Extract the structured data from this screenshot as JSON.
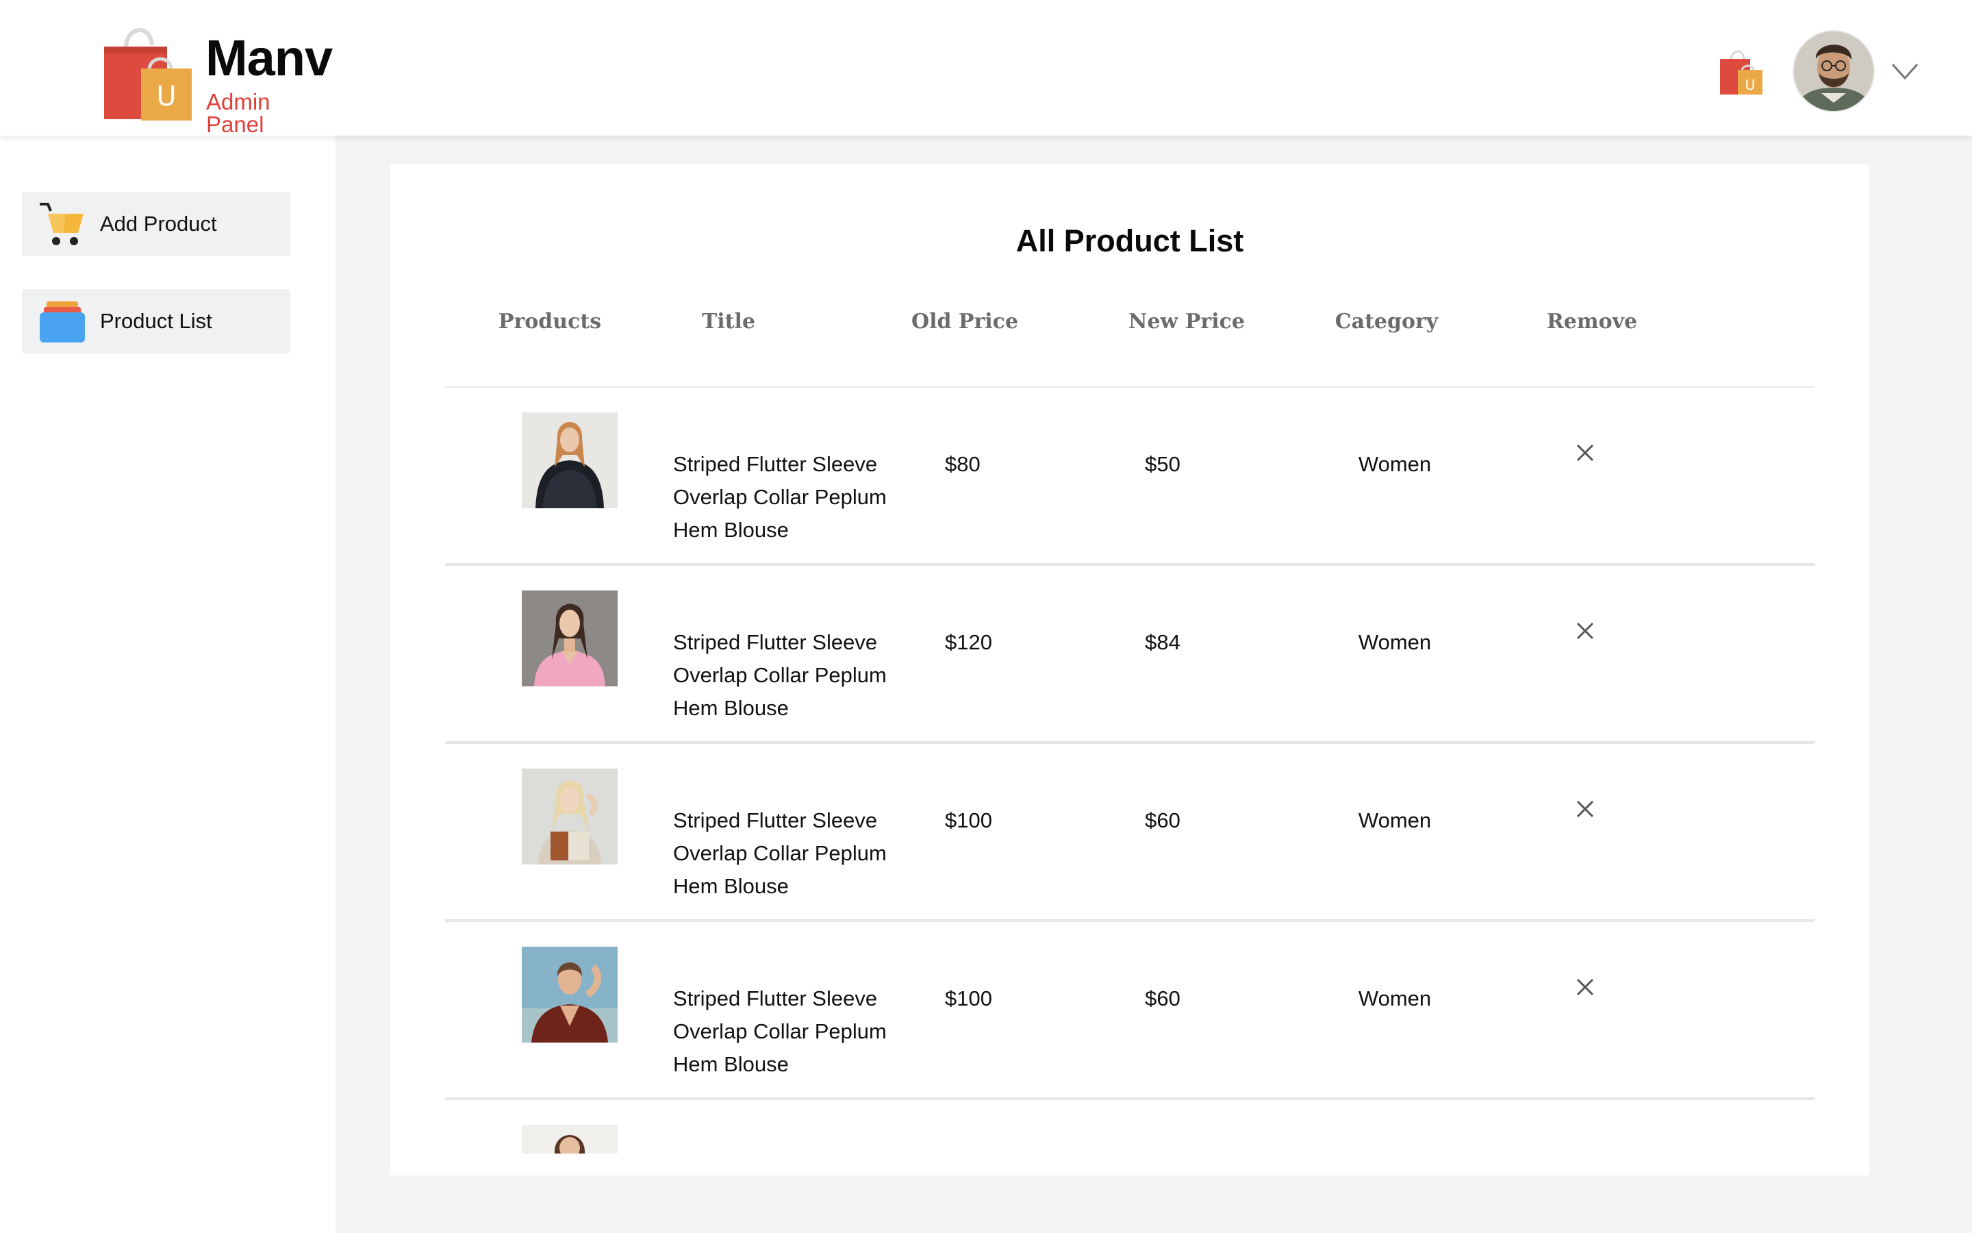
{
  "header": {
    "brand_name": "Manv",
    "brand_subtitle": "Admin Panel",
    "logo_icon": "shopping-bag-icon",
    "logo_letter": "U",
    "avatar_icon": "user-avatar",
    "dropdown_icon": "chevron-down-icon"
  },
  "sidebar": {
    "items": [
      {
        "label": "Add Product",
        "icon": "cart-icon"
      },
      {
        "label": "Product List",
        "icon": "list-icon"
      }
    ]
  },
  "main": {
    "title": "All Product List",
    "columns": [
      "Products",
      "Title",
      "Old Price",
      "New Price",
      "Category",
      "Remove"
    ],
    "rows": [
      {
        "title": "Striped Flutter Sleeve Overlap Collar Peplum Hem Blouse",
        "old_price": "$80",
        "new_price": "$50",
        "category": "Women"
      },
      {
        "title": "Striped Flutter Sleeve Overlap Collar Peplum Hem Blouse",
        "old_price": "$120",
        "new_price": "$84",
        "category": "Women"
      },
      {
        "title": "Striped Flutter Sleeve Overlap Collar Peplum Hem Blouse",
        "old_price": "$100",
        "new_price": "$60",
        "category": "Women"
      },
      {
        "title": "Striped Flutter Sleeve Overlap Collar Peplum Hem Blouse",
        "old_price": "$100",
        "new_price": "$60",
        "category": "Women"
      }
    ],
    "remove_icon": "close-icon"
  },
  "colors": {
    "brand_accent": "#e0413a",
    "bag_red": "#dd4b3f",
    "bag_orange": "#eaa946",
    "list_blue": "#4aa3f0",
    "page_bg": "#f3f4f6"
  }
}
